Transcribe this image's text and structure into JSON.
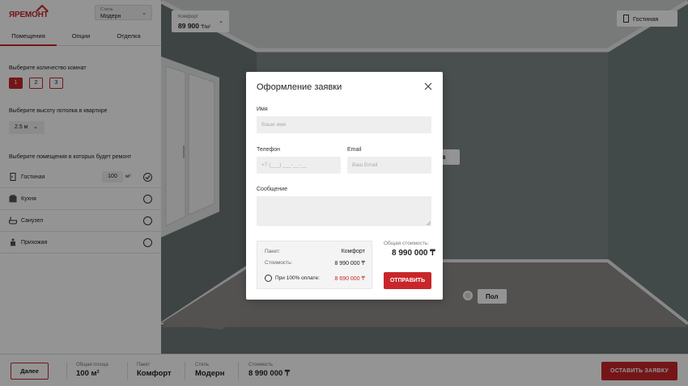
{
  "brand": {
    "logo_text": "ЯРЕМОНТ",
    "accent": "#c8262a"
  },
  "style_select": {
    "label": "Стиль",
    "value": "Модерн"
  },
  "tabs": [
    {
      "label": "Помещения",
      "active": true
    },
    {
      "label": "Опции",
      "active": false
    },
    {
      "label": "Отделка",
      "active": false
    }
  ],
  "room_count": {
    "title": "Выберите количество комнат",
    "options": [
      "1",
      "2",
      "3"
    ],
    "selected": "1"
  },
  "ceiling": {
    "title": "Выберите высоту потолка в квартире",
    "value": "2.5 м"
  },
  "rooms": {
    "title": "Выберите помещения в которых будет ремонт",
    "items": [
      {
        "name": "Гостиная",
        "area": "100",
        "unit": "м²",
        "checked": true,
        "icon": "wardrobe-icon"
      },
      {
        "name": "Кухня",
        "checked": false,
        "icon": "kitchen-icon"
      },
      {
        "name": "Санузел",
        "checked": false,
        "icon": "bathtub-icon"
      },
      {
        "name": "Прихожая",
        "checked": false,
        "icon": "hallway-icon"
      }
    ]
  },
  "package_chip": {
    "label": "Комфорт",
    "price": "89 900",
    "unit": "₸/м²"
  },
  "room_chip": {
    "label": "Гостиная"
  },
  "wall_chip": {
    "label": "на"
  },
  "floor_chip": {
    "label": "Пол"
  },
  "bottom": {
    "next_label": "Далее",
    "stats": [
      {
        "label": "Общая площа",
        "value": "100 м²"
      },
      {
        "label": "Пакет",
        "value": "Комфорт"
      },
      {
        "label": "Стиль",
        "value": "Модерн"
      },
      {
        "label": "Стоимость",
        "value": "8 990 000 ₸"
      }
    ],
    "leave_request_label": "ОСТАВИТЬ ЗАЯВКУ"
  },
  "modal": {
    "title": "Оформление заявки",
    "name_label": "Имя",
    "name_placeholder": "Ваше имя",
    "phone_label": "Телефон",
    "phone_placeholder": "+7 (___) ___-__-__",
    "email_label": "Email",
    "email_placeholder": "Ваш Email",
    "message_label": "Сообщение",
    "package_key": "Пакет:",
    "package_value": "Комфорт",
    "cost_key": "Стоимость:",
    "cost_value": "8 990 000 ₸",
    "full_pay_label": "При 100% оплате:",
    "full_pay_value": "8 690 000 ₸",
    "total_label": "Общая стоимость:",
    "total_value": "8 990 000 ₸",
    "submit_label": "ОТПРАВИТЬ"
  }
}
